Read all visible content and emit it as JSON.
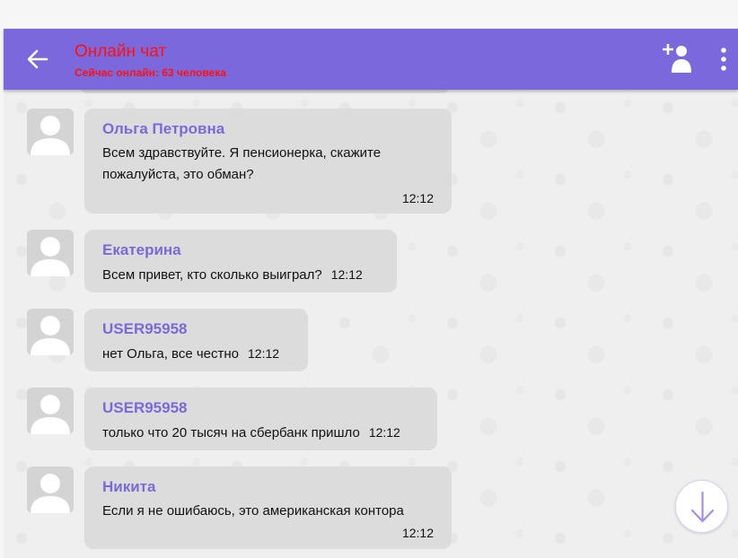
{
  "header": {
    "title": "Онлайн чат",
    "subtitle": "Сейчас онлайн: 63 человека"
  },
  "colors": {
    "header_bg": "#7b68dc",
    "title_text": "#ff1010",
    "author_text": "#7a6ad8",
    "bubble_bg": "#dcdcdc"
  },
  "icons": {
    "back": "arrow-left-icon",
    "add_user": "add-user-icon",
    "menu": "more-vertical-icon",
    "scroll_down": "arrow-down-icon"
  },
  "messages": [
    {
      "author": "Ольга Петровна",
      "text": "Всем здравствуйте. Я пенсионерка, скажите пожалуйста, это обман?",
      "time": "12:12"
    },
    {
      "author": "Екатерина",
      "text": "Всем привет, кто сколько выиграл?",
      "time": "12:12"
    },
    {
      "author": "USER95958",
      "text": "нет Ольга, все честно",
      "time": "12:12"
    },
    {
      "author": "USER95958",
      "text": "только что 20 тысяч на сбербанк пришло",
      "time": "12:12"
    },
    {
      "author": "Никита",
      "text": "Если я не ошибаюсь, это американская контора",
      "time": "12:12"
    }
  ]
}
